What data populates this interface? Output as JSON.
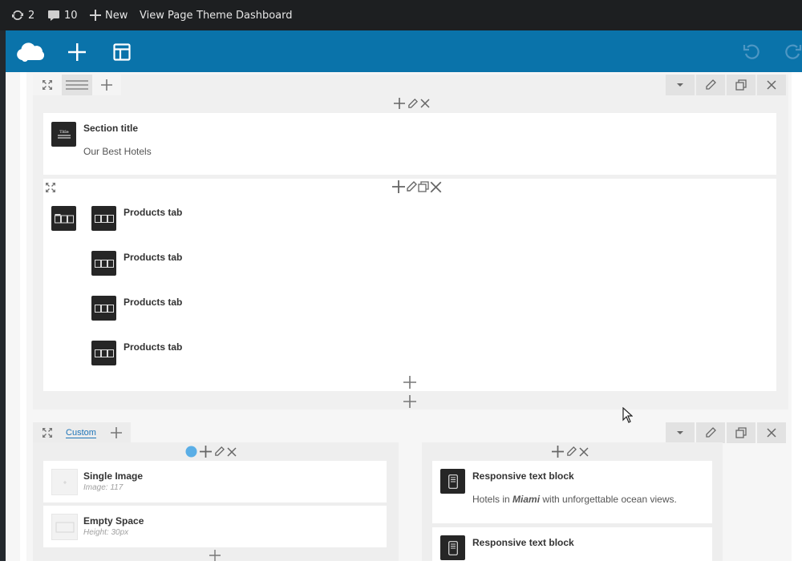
{
  "admin_bar": {
    "updates_count": "2",
    "comments_count": "10",
    "new_label": "New",
    "view_page_label": "View Page",
    "theme_dashboard_label": "Theme Dashboard"
  },
  "editor_toolbar": {
    "icons": [
      "logo-icon",
      "add-element-icon",
      "templates-icon",
      "undo-icon",
      "redo-icon"
    ]
  },
  "row1": {
    "section_title": {
      "title": "Section title",
      "subtitle": "Our Best Hotels"
    },
    "products": {
      "items": [
        "Products tab",
        "Products tab",
        "Products tab",
        "Products tab"
      ]
    }
  },
  "row2": {
    "tab_label": "Custom",
    "left_column": {
      "single_image": {
        "title": "Single Image",
        "meta": "Image: 117"
      },
      "empty_space": {
        "title": "Empty Space",
        "meta": "Height: 30px"
      }
    },
    "right_column": {
      "text_block_1": {
        "title": "Responsive text block",
        "text_before": "Hotels in ",
        "text_em": "Miami",
        "text_after": " with unforgettable ocean views."
      },
      "text_block_2": {
        "title": "Responsive text block"
      }
    }
  },
  "colors": {
    "admin_bar_bg": "#1d1f21",
    "toolbar_bg": "#0a73aa",
    "accent_dot": "#5aaee6"
  }
}
